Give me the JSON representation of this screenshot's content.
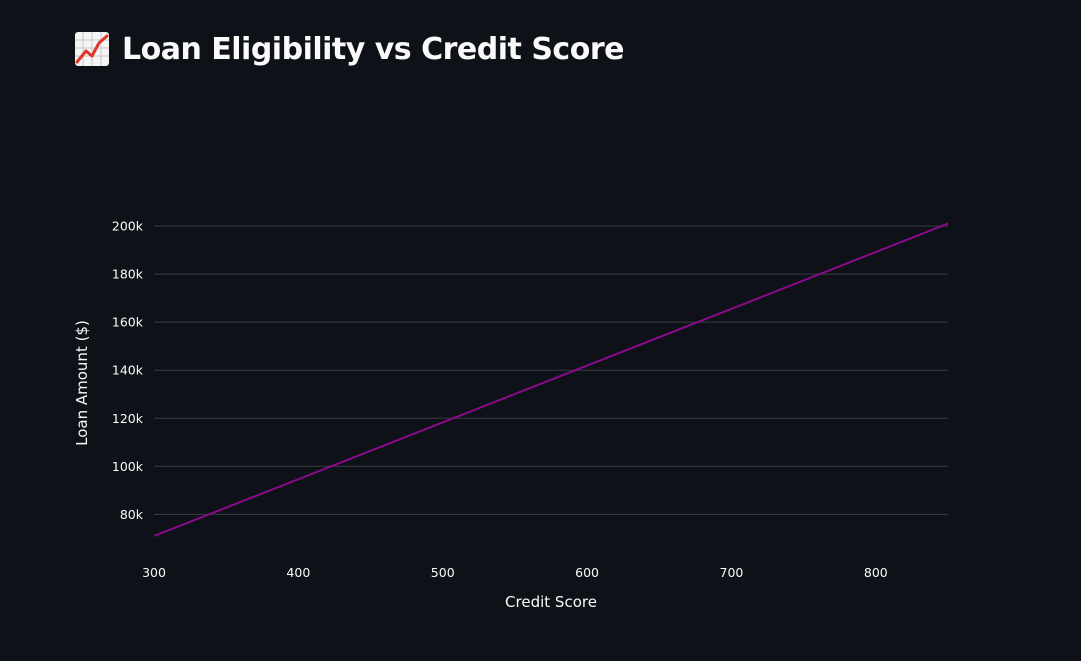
{
  "header": {
    "title": "Loan Eligibility vs Credit Score",
    "icon": "chart-increasing-icon"
  },
  "colors": {
    "background": "#0e1117",
    "line": "#8b0a8b",
    "grid": "#3a3d45",
    "text": "#fafafa"
  },
  "chart_data": {
    "type": "line",
    "xlabel": "Credit Score",
    "ylabel": "Loan Amount ($)",
    "xlim": [
      300,
      850
    ],
    "ylim": [
      66000,
      210000
    ],
    "x_ticks": [
      300,
      400,
      500,
      600,
      700,
      800
    ],
    "x_tick_labels": [
      "300",
      "400",
      "500",
      "600",
      "700",
      "800"
    ],
    "y_ticks": [
      80000,
      100000,
      120000,
      140000,
      160000,
      180000,
      200000
    ],
    "y_tick_labels": [
      "80k",
      "100k",
      "120k",
      "140k",
      "160k",
      "180k",
      "200k"
    ],
    "grid": true,
    "series": [
      {
        "x": [
          300,
          850
        ],
        "y": [
          71000,
          201000
        ]
      }
    ]
  }
}
